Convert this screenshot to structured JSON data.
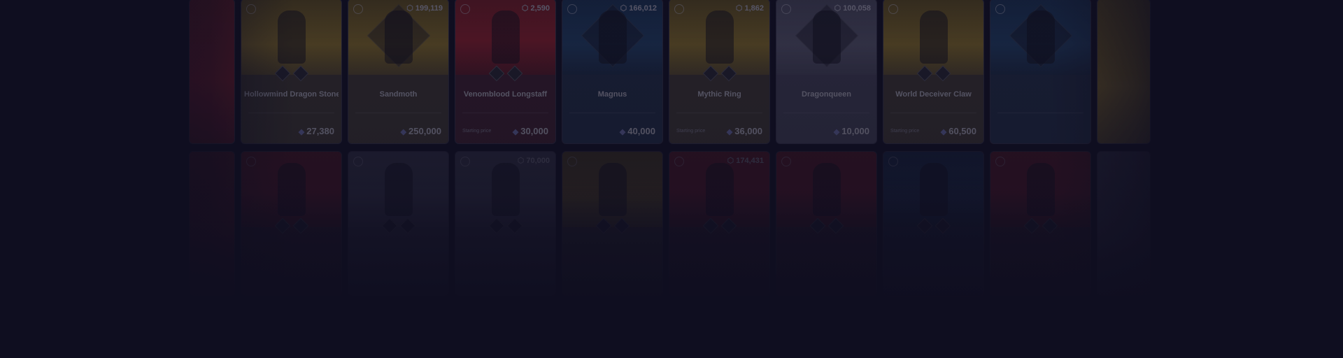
{
  "row1": [
    {
      "name": "",
      "sub": "",
      "supply": "",
      "price": "",
      "price_label": "",
      "tone": "red",
      "edge": true
    },
    {
      "name": "Hollowmind Dragon Stone",
      "sub": "",
      "supply": "",
      "price": "27,380",
      "price_label": "",
      "tone": "gold",
      "edge": false,
      "icon": "boots-icon"
    },
    {
      "name": "Sandmoth",
      "sub": "",
      "supply": "199,119",
      "price": "250,000",
      "price_label": "",
      "tone": "gold",
      "edge": false,
      "icon": "character-icon"
    },
    {
      "name": "Venomblood Longstaff",
      "sub": "",
      "supply": "2,590",
      "price": "30,000",
      "price_label": "Starting price",
      "tone": "red",
      "edge": false,
      "icon": "staff-icon"
    },
    {
      "name": "Magnus",
      "sub": "",
      "supply": "166,012",
      "price": "40,000",
      "price_label": "",
      "tone": "blue",
      "edge": false,
      "icon": "character-icon"
    },
    {
      "name": "Mythic Ring",
      "sub": "",
      "supply": "1,862",
      "price": "36,000",
      "price_label": "Starting price",
      "tone": "gold",
      "edge": false,
      "icon": "ring-icon"
    },
    {
      "name": "Dragonqueen",
      "sub": "",
      "supply": "100,058",
      "price": "10,000",
      "price_label": "",
      "tone": "grey",
      "edge": false,
      "icon": "character-icon"
    },
    {
      "name": "World Deceiver Claw",
      "sub": "",
      "supply": "",
      "price": "60,500",
      "price_label": "Starting price",
      "tone": "gold",
      "edge": false,
      "icon": "claw-icon"
    },
    {
      "name": "",
      "sub": "",
      "supply": "",
      "price": "",
      "price_label": "",
      "tone": "blue",
      "edge": false,
      "icon": "character-icon"
    },
    {
      "name": "",
      "sub": "",
      "supply": "",
      "price": "",
      "price_label": "",
      "tone": "gold",
      "edge": true
    }
  ],
  "row2": [
    {
      "tone": "red",
      "edge": true,
      "supply": "",
      "name": ""
    },
    {
      "tone": "red",
      "edge": false,
      "supply": "",
      "name": ""
    },
    {
      "tone": "grey",
      "edge": false,
      "supply": "",
      "name": ""
    },
    {
      "tone": "grey",
      "edge": false,
      "supply": "70,000",
      "name": ""
    },
    {
      "tone": "gold",
      "edge": false,
      "supply": "",
      "name": ""
    },
    {
      "tone": "red",
      "edge": false,
      "supply": "174,431",
      "name": ""
    },
    {
      "tone": "red",
      "edge": false,
      "supply": "",
      "name": ""
    },
    {
      "tone": "blue",
      "edge": false,
      "supply": "",
      "name": ""
    },
    {
      "tone": "red",
      "edge": false,
      "supply": "",
      "name": ""
    },
    {
      "tone": "grey",
      "edge": true,
      "supply": "",
      "name": ""
    }
  ]
}
